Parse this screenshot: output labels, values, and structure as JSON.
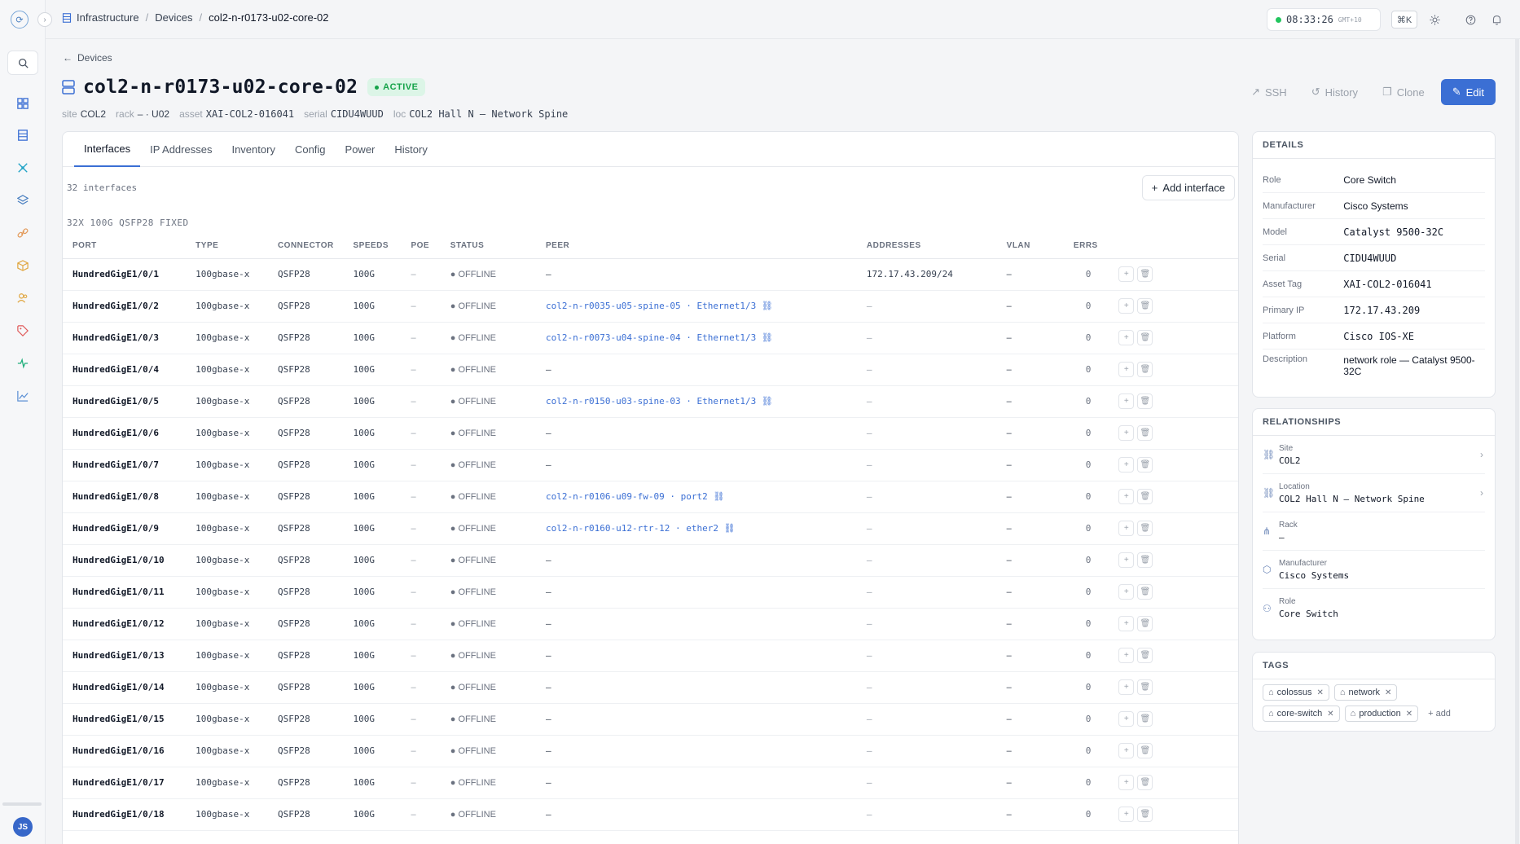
{
  "breadcrumb": {
    "root": "Infrastructure",
    "section": "Devices",
    "current": "col2-n-r0173-u02-core-02"
  },
  "clock": {
    "time": "08:33:26",
    "tz": "GMT+10"
  },
  "shortcut": "⌘K",
  "back_label": "Devices",
  "device": {
    "name": "col2-n-r0173-u02-core-02",
    "status": "ACTIVE",
    "meta": [
      {
        "k": "site",
        "v": "COL2"
      },
      {
        "k": "rack",
        "v": "– · U02"
      },
      {
        "k": "asset",
        "v": "XAI-COL2-016041"
      },
      {
        "k": "serial",
        "v": "CIDU4WUUD"
      },
      {
        "k": "loc",
        "v": "COL2 Hall N — Network Spine"
      }
    ]
  },
  "actions": {
    "ssh": "SSH",
    "history": "History",
    "clone": "Clone",
    "edit": "Edit"
  },
  "tabs": [
    "Interfaces",
    "IP Addresses",
    "Inventory",
    "Config",
    "Power",
    "History"
  ],
  "interfaces": {
    "count_label": "32 interfaces",
    "add_label": "Add interface",
    "group_label": "32X 100G QSFP28 FIXED",
    "columns": [
      "PORT",
      "TYPE",
      "CONNECTOR",
      "SPEEDS",
      "POE",
      "STATUS",
      "PEER",
      "ADDRESSES",
      "VLAN",
      "ERRS"
    ],
    "rows": [
      {
        "port": "HundredGigE1/0/1",
        "type": "100gbase-x",
        "conn": "QSFP28",
        "speed": "100G",
        "poe": "–",
        "status": "OFFLINE",
        "peer": "–",
        "addr": "172.17.43.209/24",
        "vlan": "–",
        "errs": "0"
      },
      {
        "port": "HundredGigE1/0/2",
        "type": "100gbase-x",
        "conn": "QSFP28",
        "speed": "100G",
        "poe": "–",
        "status": "OFFLINE",
        "peer": "col2-n-r0035-u05-spine-05 · Ethernet1/3 ⛓",
        "addr": "–",
        "vlan": "–",
        "errs": "0"
      },
      {
        "port": "HundredGigE1/0/3",
        "type": "100gbase-x",
        "conn": "QSFP28",
        "speed": "100G",
        "poe": "–",
        "status": "OFFLINE",
        "peer": "col2-n-r0073-u04-spine-04 · Ethernet1/3 ⛓",
        "addr": "–",
        "vlan": "–",
        "errs": "0"
      },
      {
        "port": "HundredGigE1/0/4",
        "type": "100gbase-x",
        "conn": "QSFP28",
        "speed": "100G",
        "poe": "–",
        "status": "OFFLINE",
        "peer": "–",
        "addr": "–",
        "vlan": "–",
        "errs": "0"
      },
      {
        "port": "HundredGigE1/0/5",
        "type": "100gbase-x",
        "conn": "QSFP28",
        "speed": "100G",
        "poe": "–",
        "status": "OFFLINE",
        "peer": "col2-n-r0150-u03-spine-03 · Ethernet1/3 ⛓",
        "addr": "–",
        "vlan": "–",
        "errs": "0"
      },
      {
        "port": "HundredGigE1/0/6",
        "type": "100gbase-x",
        "conn": "QSFP28",
        "speed": "100G",
        "poe": "–",
        "status": "OFFLINE",
        "peer": "–",
        "addr": "–",
        "vlan": "–",
        "errs": "0"
      },
      {
        "port": "HundredGigE1/0/7",
        "type": "100gbase-x",
        "conn": "QSFP28",
        "speed": "100G",
        "poe": "–",
        "status": "OFFLINE",
        "peer": "–",
        "addr": "–",
        "vlan": "–",
        "errs": "0"
      },
      {
        "port": "HundredGigE1/0/8",
        "type": "100gbase-x",
        "conn": "QSFP28",
        "speed": "100G",
        "poe": "–",
        "status": "OFFLINE",
        "peer": "col2-n-r0106-u09-fw-09 · port2 ⛓",
        "addr": "–",
        "vlan": "–",
        "errs": "0"
      },
      {
        "port": "HundredGigE1/0/9",
        "type": "100gbase-x",
        "conn": "QSFP28",
        "speed": "100G",
        "poe": "–",
        "status": "OFFLINE",
        "peer": "col2-n-r0160-u12-rtr-12 · ether2 ⛓",
        "addr": "–",
        "vlan": "–",
        "errs": "0"
      },
      {
        "port": "HundredGigE1/0/10",
        "type": "100gbase-x",
        "conn": "QSFP28",
        "speed": "100G",
        "poe": "–",
        "status": "OFFLINE",
        "peer": "–",
        "addr": "–",
        "vlan": "–",
        "errs": "0"
      },
      {
        "port": "HundredGigE1/0/11",
        "type": "100gbase-x",
        "conn": "QSFP28",
        "speed": "100G",
        "poe": "–",
        "status": "OFFLINE",
        "peer": "–",
        "addr": "–",
        "vlan": "–",
        "errs": "0"
      },
      {
        "port": "HundredGigE1/0/12",
        "type": "100gbase-x",
        "conn": "QSFP28",
        "speed": "100G",
        "poe": "–",
        "status": "OFFLINE",
        "peer": "–",
        "addr": "–",
        "vlan": "–",
        "errs": "0"
      },
      {
        "port": "HundredGigE1/0/13",
        "type": "100gbase-x",
        "conn": "QSFP28",
        "speed": "100G",
        "poe": "–",
        "status": "OFFLINE",
        "peer": "–",
        "addr": "–",
        "vlan": "–",
        "errs": "0"
      },
      {
        "port": "HundredGigE1/0/14",
        "type": "100gbase-x",
        "conn": "QSFP28",
        "speed": "100G",
        "poe": "–",
        "status": "OFFLINE",
        "peer": "–",
        "addr": "–",
        "vlan": "–",
        "errs": "0"
      },
      {
        "port": "HundredGigE1/0/15",
        "type": "100gbase-x",
        "conn": "QSFP28",
        "speed": "100G",
        "poe": "–",
        "status": "OFFLINE",
        "peer": "–",
        "addr": "–",
        "vlan": "–",
        "errs": "0"
      },
      {
        "port": "HundredGigE1/0/16",
        "type": "100gbase-x",
        "conn": "QSFP28",
        "speed": "100G",
        "poe": "–",
        "status": "OFFLINE",
        "peer": "–",
        "addr": "–",
        "vlan": "–",
        "errs": "0"
      },
      {
        "port": "HundredGigE1/0/17",
        "type": "100gbase-x",
        "conn": "QSFP28",
        "speed": "100G",
        "poe": "–",
        "status": "OFFLINE",
        "peer": "–",
        "addr": "–",
        "vlan": "–",
        "errs": "0"
      },
      {
        "port": "HundredGigE1/0/18",
        "type": "100gbase-x",
        "conn": "QSFP28",
        "speed": "100G",
        "poe": "–",
        "status": "OFFLINE",
        "peer": "–",
        "addr": "–",
        "vlan": "–",
        "errs": "0"
      }
    ]
  },
  "details": {
    "title": "DETAILS",
    "rows": [
      {
        "k": "Role",
        "v": "Core Switch"
      },
      {
        "k": "Manufacturer",
        "v": "Cisco Systems"
      },
      {
        "k": "Model",
        "v": "Catalyst 9500-32C"
      },
      {
        "k": "Serial",
        "v": "CIDU4WUUD"
      },
      {
        "k": "Asset Tag",
        "v": "XAI-COL2-016041"
      },
      {
        "k": "Primary IP",
        "v": "172.17.43.209"
      },
      {
        "k": "Platform",
        "v": "Cisco IOS-XE"
      },
      {
        "k": "Description",
        "v": "network role — Catalyst 9500-32C"
      }
    ]
  },
  "relationships": {
    "title": "RELATIONSHIPS",
    "rows": [
      {
        "k": "Site",
        "v": "COL2",
        "icon": "link-icon"
      },
      {
        "k": "Location",
        "v": "COL2 Hall N — Network Spine",
        "icon": "link-icon"
      },
      {
        "k": "Rack",
        "v": "–",
        "icon": "rack-icon"
      },
      {
        "k": "Manufacturer",
        "v": "Cisco Systems",
        "icon": "box-icon"
      },
      {
        "k": "Role",
        "v": "Core Switch",
        "icon": "users-icon"
      }
    ]
  },
  "tags": {
    "title": "TAGS",
    "items": [
      "colossus",
      "network",
      "core-switch",
      "production"
    ],
    "add_label": "+ add"
  },
  "user": {
    "initials": "JS"
  }
}
